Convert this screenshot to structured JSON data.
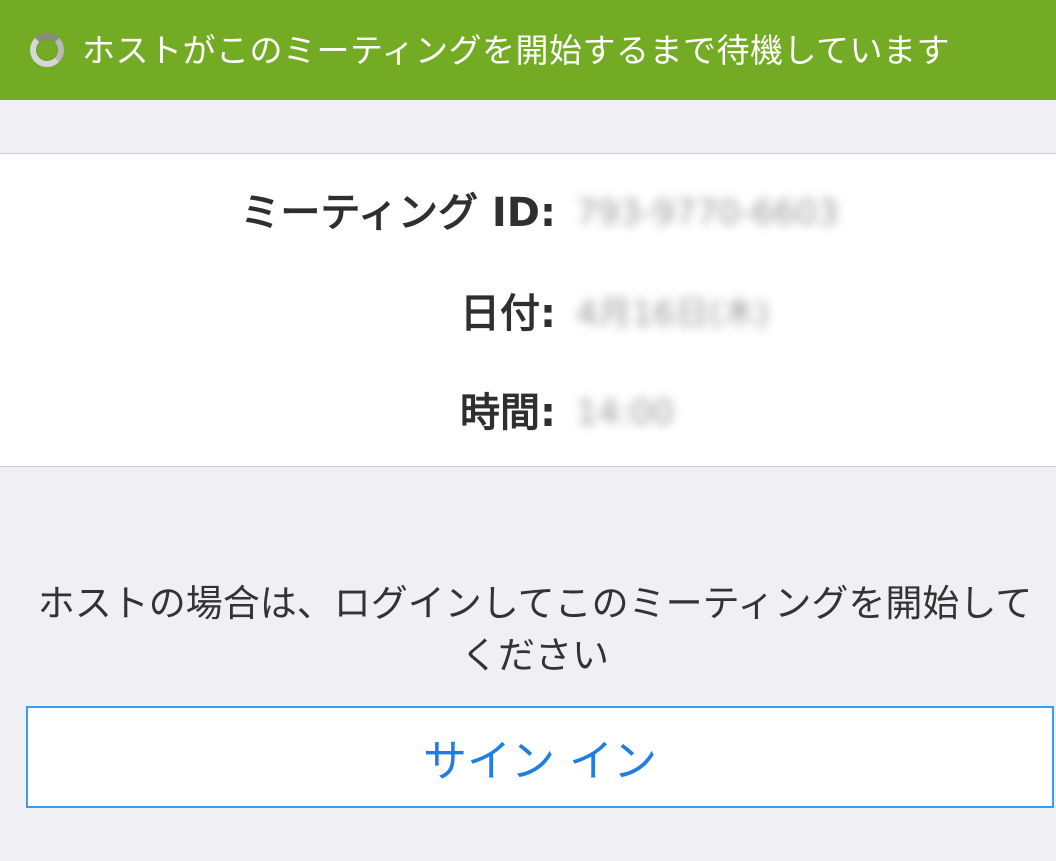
{
  "banner": {
    "status_text": "ホストがこのミーティングを開始するまで待機しています",
    "spinner_icon": "loading-spinner-icon",
    "color": "#74ab24"
  },
  "meeting_info": {
    "meeting_id_label": "ミーティング ID:",
    "meeting_id_value": "793-9770-6603",
    "date_label": "日付:",
    "date_value": "4月16日(木)",
    "time_label": "時間:",
    "time_value": "14:00"
  },
  "host_message": "ホストの場合は、ログインしてこのミーティングを開始してください",
  "signin_button_label": "サイン イン",
  "colors": {
    "accent_blue": "#1f7fe0",
    "background": "#efeff4"
  }
}
